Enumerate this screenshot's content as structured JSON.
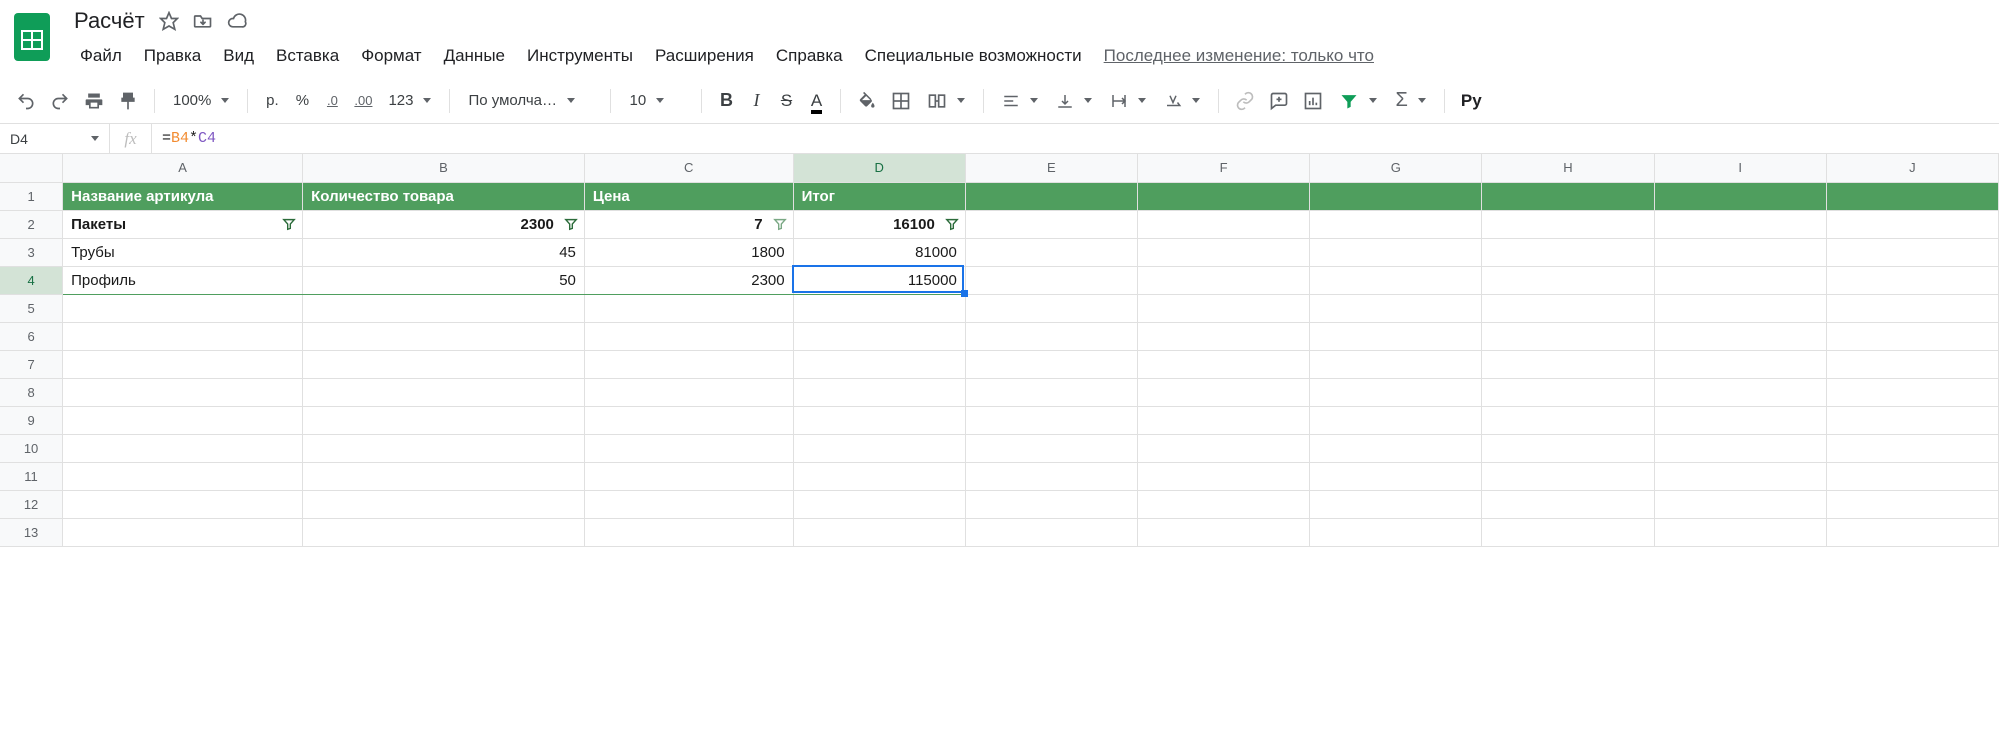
{
  "doc": {
    "title": "Расчёт"
  },
  "menu": {
    "items": [
      "Файл",
      "Правка",
      "Вид",
      "Вставка",
      "Формат",
      "Данные",
      "Инструменты",
      "Расширения",
      "Справка",
      "Специальные возможности"
    ],
    "last_edit": "Последнее изменение: только что"
  },
  "toolbar": {
    "zoom": "100%",
    "currency": "р.",
    "percent": "%",
    "dec_dec": ".0",
    "dec_inc": ".00",
    "numfmt": "123",
    "font": "По умолча…",
    "font_size": "10",
    "py": "Py"
  },
  "fx": {
    "namebox": "D4",
    "formula_eq": "=",
    "formula_ref1": "B4",
    "formula_op": "*",
    "formula_ref2": "C4"
  },
  "columns": [
    "A",
    "B",
    "C",
    "D",
    "E",
    "F",
    "G",
    "H",
    "I",
    "J"
  ],
  "row_headers": [
    "1",
    "2",
    "3",
    "4",
    "5",
    "6",
    "7",
    "8",
    "9",
    "10",
    "11",
    "12",
    "13"
  ],
  "selected_col_index": 3,
  "selected_row_index": 3,
  "sheet": {
    "header": [
      "Название артикула",
      "Количество товара",
      "Цена",
      "Итог"
    ],
    "rows": [
      {
        "name": "Пакеты",
        "qty": "2300",
        "price": "7",
        "total": "16100",
        "bold": true
      },
      {
        "name": "Трубы",
        "qty": "45",
        "price": "1800",
        "total": "81000",
        "bold": false
      },
      {
        "name": "Профиль",
        "qty": "50",
        "price": "2300",
        "total": "115000",
        "bold": false
      }
    ]
  },
  "chart_data": {
    "type": "table",
    "columns": [
      "Название артикула",
      "Количество товара",
      "Цена",
      "Итог"
    ],
    "rows": [
      [
        "Пакеты",
        2300,
        7,
        16100
      ],
      [
        "Трубы",
        45,
        1800,
        81000
      ],
      [
        "Профиль",
        50,
        2300,
        115000
      ]
    ]
  }
}
